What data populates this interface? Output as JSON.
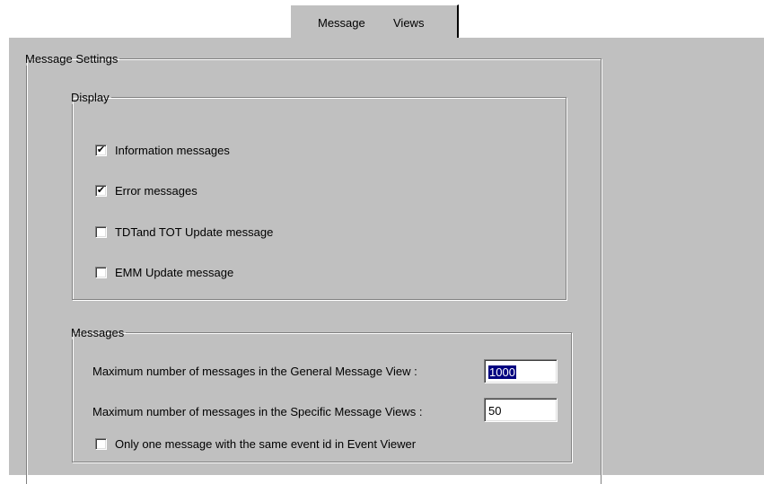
{
  "tabs": [
    {
      "label": "Message"
    },
    {
      "label": "Views"
    }
  ],
  "message_settings": {
    "legend": "Message Settings",
    "display": {
      "legend": "Display",
      "options": [
        {
          "label": "Information messages",
          "checked": true,
          "mark": "✔"
        },
        {
          "label": "Error messages",
          "checked": true,
          "mark": "✔"
        },
        {
          "label": "TDTand TOT Update message",
          "checked": false,
          "mark": ""
        },
        {
          "label": "EMM Update message",
          "checked": false,
          "mark": ""
        }
      ]
    },
    "messages": {
      "legend": "Messages",
      "general_label": "Maximum number of messages in the General Message View :",
      "general_value": "1000",
      "specific_label": "Maximum number of messages in the Specific Message Views :",
      "specific_value": "50",
      "unique_event": {
        "label": "Only one message with the same event id in Event Viewer",
        "checked": false,
        "mark": ""
      }
    }
  },
  "colors": {
    "dialog_bg": "#c0c0c0",
    "selection_bg": "#000080"
  }
}
